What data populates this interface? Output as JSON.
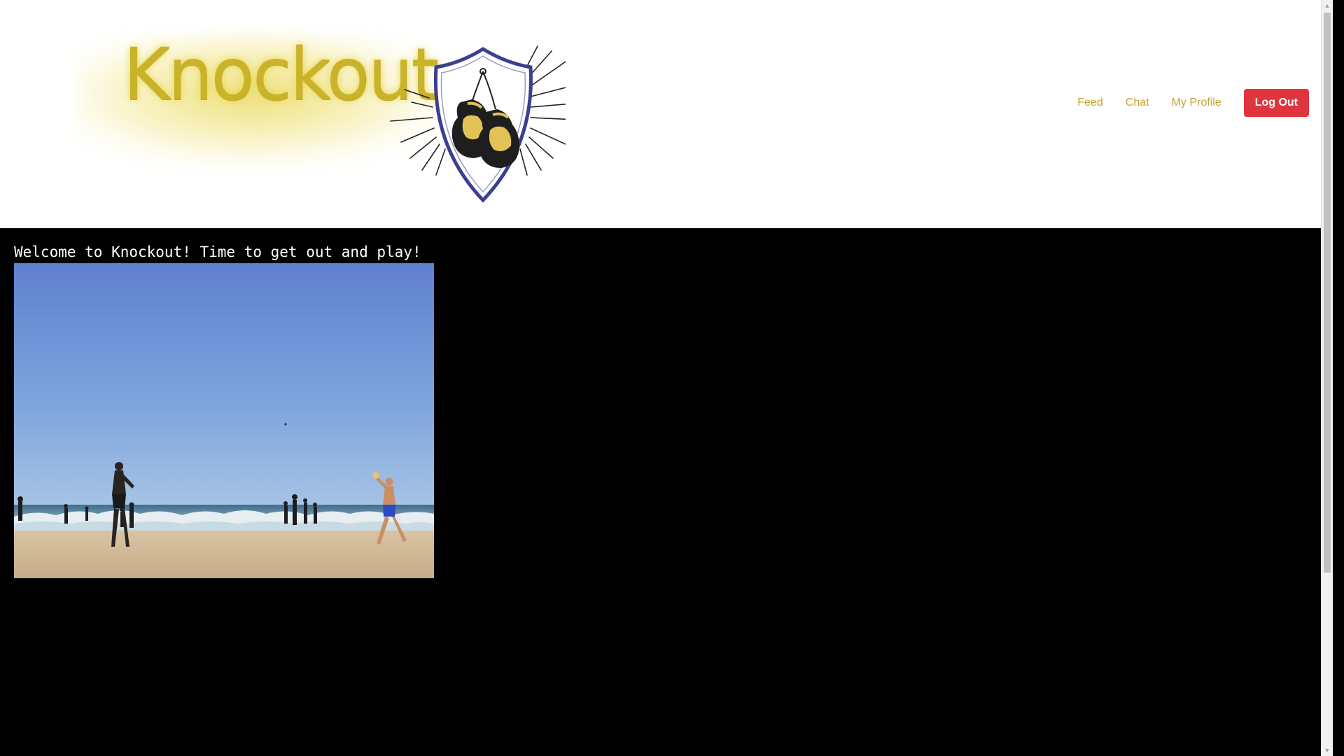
{
  "header": {
    "logo_text": "Knockout",
    "nav": {
      "feed_label": "Feed",
      "chat_label": "Chat",
      "profile_label": "My Profile",
      "logout_label": "Log Out"
    }
  },
  "main": {
    "welcome_text": "Welcome to Knockout! Time to get out and play!"
  },
  "colors": {
    "header_bg": "#ffffff",
    "page_bg": "#000000",
    "nav_link": "#c7a42e",
    "logout_bg": "#e0353f",
    "logo_gold": "#c8b32a",
    "shield_border": "#3b3f8f"
  },
  "icons": {
    "logo_emblem": "boxing-gloves-shield-icon",
    "scroll_up": "triangle-up-icon",
    "scroll_down": "triangle-down-icon"
  }
}
